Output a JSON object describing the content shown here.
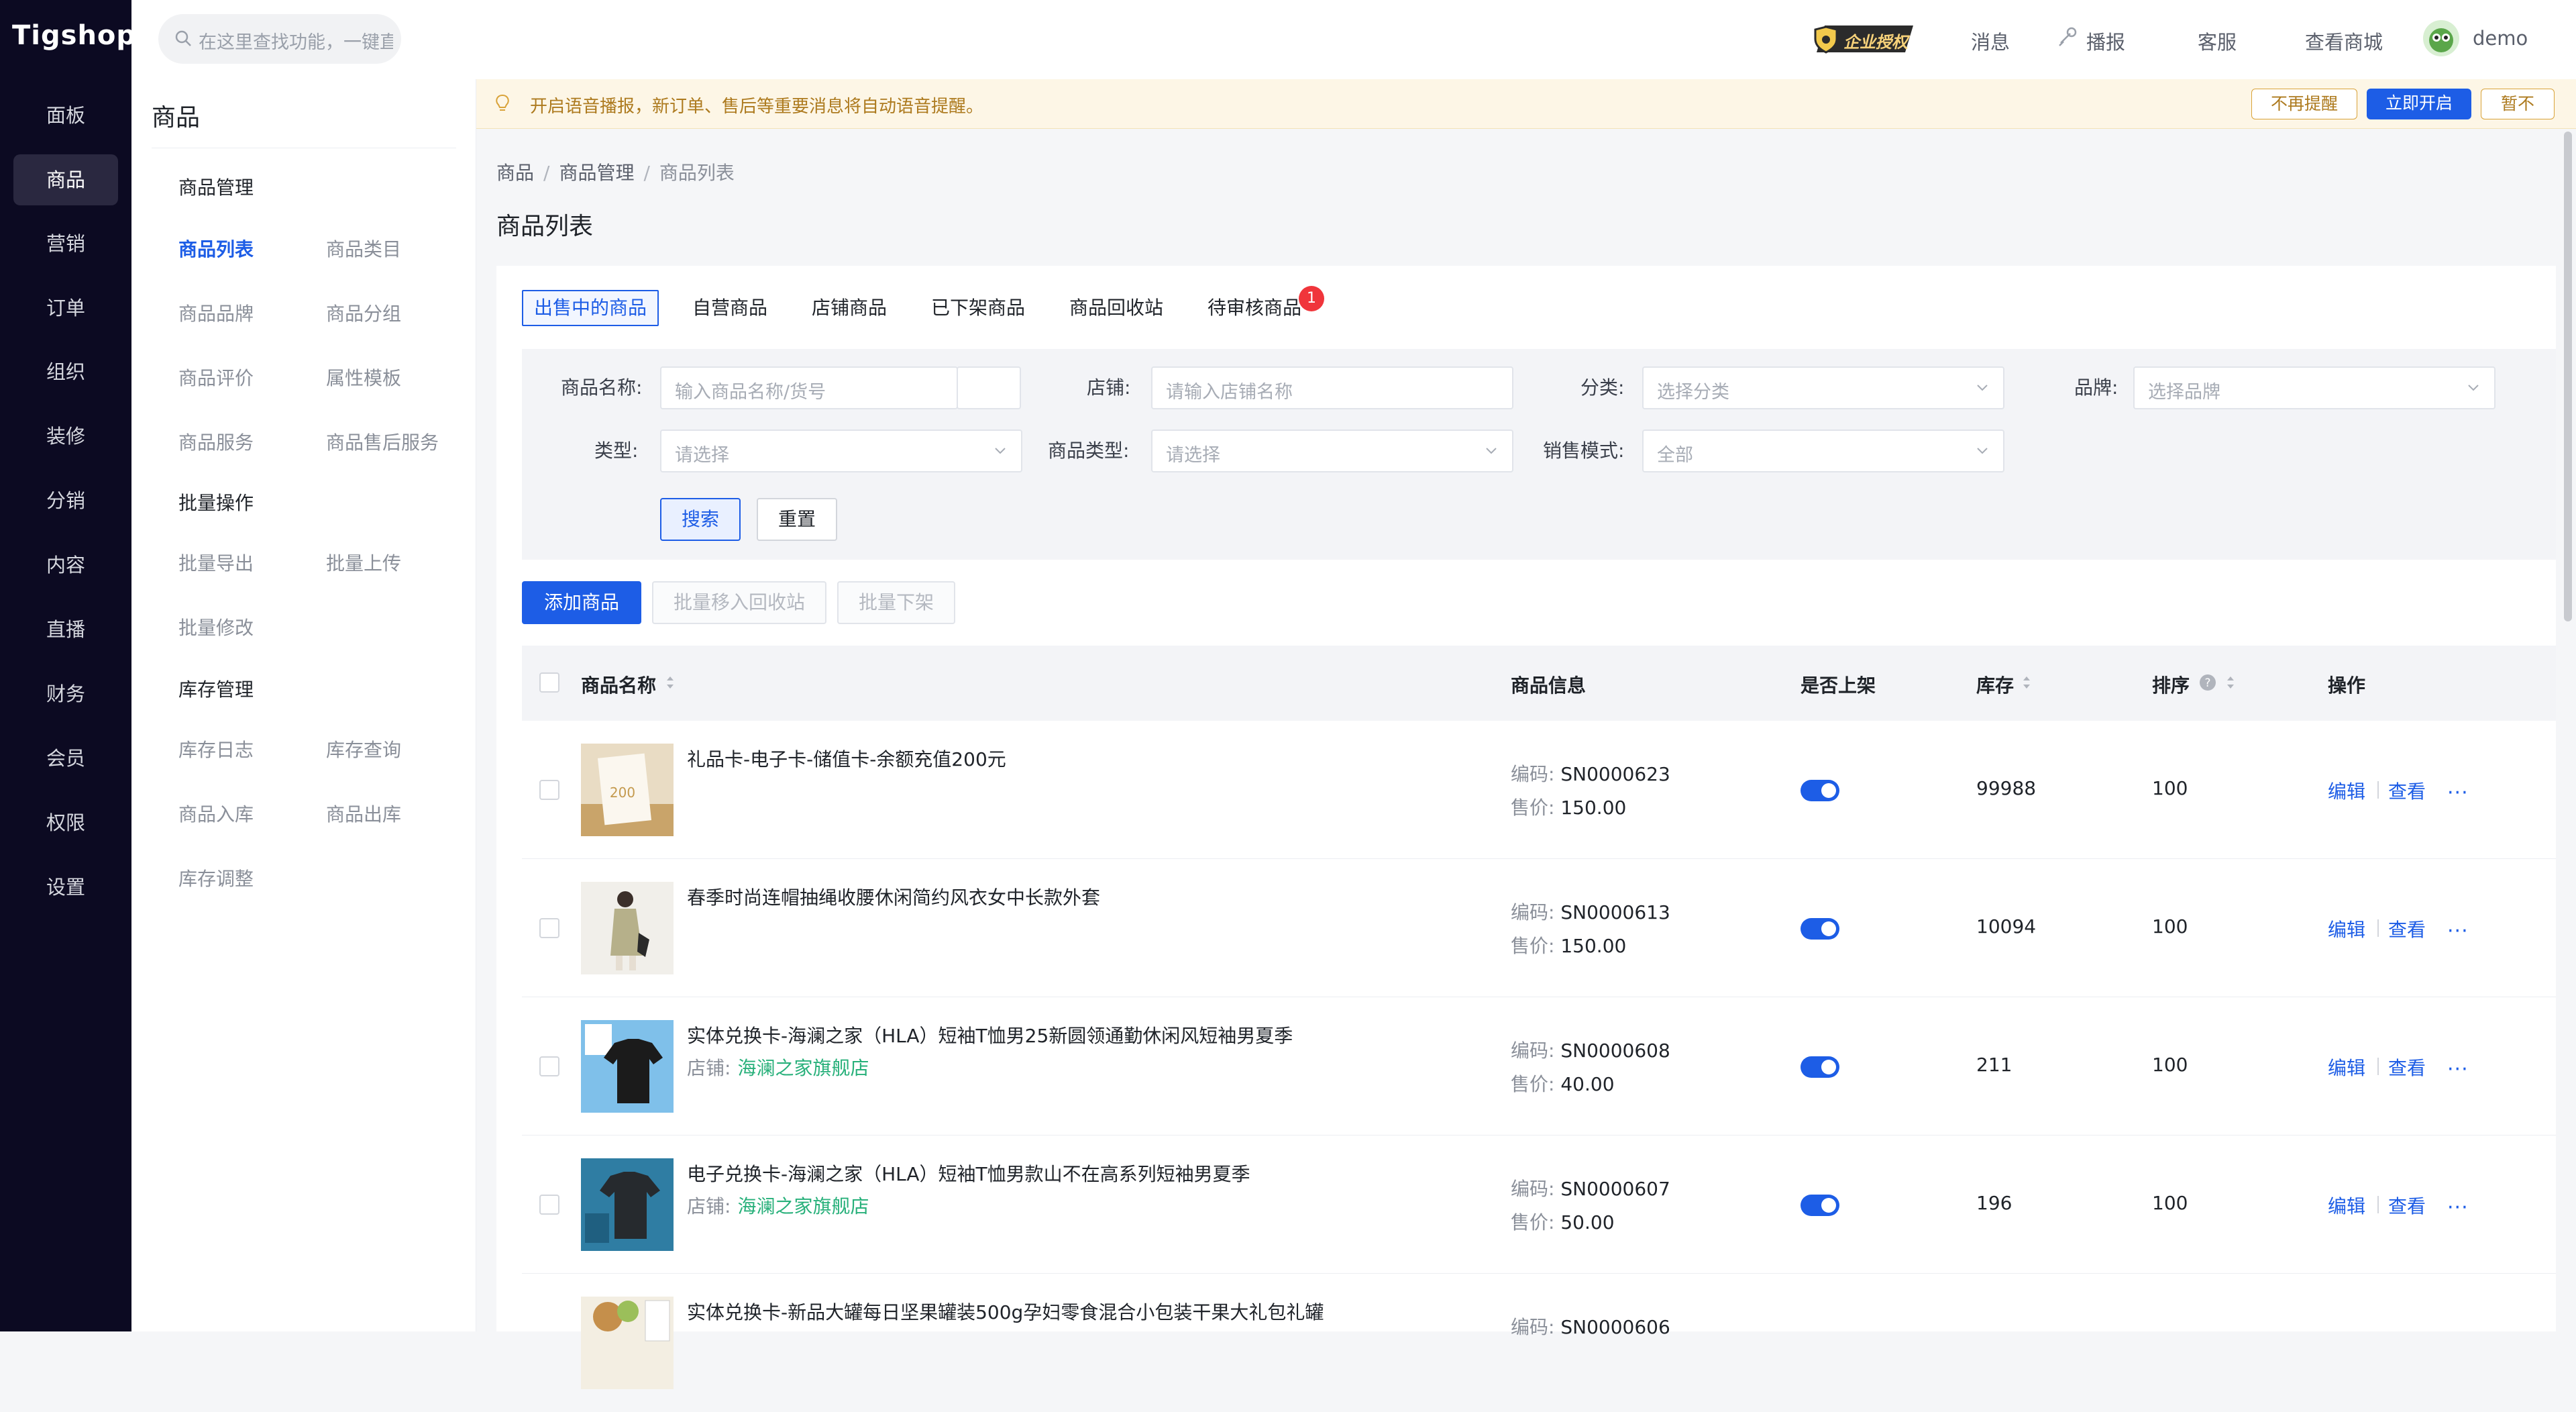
{
  "app": {
    "logo": "Tigshop"
  },
  "leftnav": {
    "items": [
      {
        "label": "面板"
      },
      {
        "label": "商品"
      },
      {
        "label": "营销"
      },
      {
        "label": "订单"
      },
      {
        "label": "组织"
      },
      {
        "label": "装修"
      },
      {
        "label": "分销"
      },
      {
        "label": "内容"
      },
      {
        "label": "直播"
      },
      {
        "label": "财务"
      },
      {
        "label": "会员"
      },
      {
        "label": "权限"
      },
      {
        "label": "设置"
      }
    ],
    "active_index": 1
  },
  "topbar": {
    "search_placeholder": "在这里查找功能，一键直达",
    "badge": "企业授权",
    "links": {
      "messages": "消息",
      "broadcast": "播报",
      "service": "客服",
      "view_shop": "查看商城"
    },
    "user": "demo"
  },
  "notice": {
    "text": "开启语音播报，新订单、售后等重要消息将自动语音提醒。",
    "no_remind": "不再提醒",
    "enable_now": "立即开启",
    "later": "暂不"
  },
  "submenu": {
    "title": "商品",
    "groups": [
      {
        "title": "商品管理",
        "items": [
          "商品列表",
          "商品类目",
          "商品品牌",
          "商品分组",
          "商品评价",
          "属性模板",
          "商品服务",
          "商品售后服务"
        ]
      },
      {
        "title": "批量操作",
        "items": [
          "批量导出",
          "批量上传",
          "批量修改"
        ]
      },
      {
        "title": "库存管理",
        "items": [
          "库存日志",
          "库存查询",
          "商品入库",
          "商品出库",
          "库存调整"
        ]
      }
    ]
  },
  "breadcrumb": [
    "商品",
    "商品管理",
    "商品列表"
  ],
  "page_title": "商品列表",
  "tabs": [
    {
      "label": "出售中的商品"
    },
    {
      "label": "自营商品"
    },
    {
      "label": "店铺商品"
    },
    {
      "label": "已下架商品"
    },
    {
      "label": "商品回收站"
    },
    {
      "label": "待审核商品",
      "badge": "1"
    }
  ],
  "filter": {
    "name_label": "商品名称:",
    "name_placeholder": "输入商品名称/货号",
    "shop_label": "店铺:",
    "shop_placeholder": "请输入店铺名称",
    "category_label": "分类:",
    "category_placeholder": "选择分类",
    "brand_label": "品牌:",
    "brand_placeholder": "选择品牌",
    "type_label": "类型:",
    "type_placeholder": "请选择",
    "goods_type_label": "商品类型:",
    "goods_type_placeholder": "请选择",
    "sale_mode_label": "销售模式:",
    "sale_mode_value": "全部",
    "search": "搜索",
    "reset": "重置"
  },
  "actions": {
    "add": "添加商品",
    "batch_recycle": "批量移入回收站",
    "batch_off": "批量下架"
  },
  "table": {
    "headers": {
      "name": "商品名称",
      "info": "商品信息",
      "on_sale": "是否上架",
      "stock": "库存",
      "sort": "排序",
      "ops": "操作"
    },
    "code_label": "编码:",
    "price_label": "售价:",
    "shop_label": "店铺:",
    "edit": "编辑",
    "view": "查看",
    "rows": [
      {
        "name": "礼品卡-电子卡-储值卡-余额充值200元",
        "shop": "",
        "code": "SN0000623",
        "price": "150.00",
        "on_sale": true,
        "stock": "99988",
        "sort": "100"
      },
      {
        "name": "春季时尚连帽抽绳收腰休闲简约风衣女中长款外套",
        "shop": "",
        "code": "SN0000613",
        "price": "150.00",
        "on_sale": true,
        "stock": "10094",
        "sort": "100"
      },
      {
        "name": "实体兑换卡-海澜之家（HLA）短袖T恤男25新圆领通勤休闲风短袖男夏季",
        "shop": "海澜之家旗舰店",
        "code": "SN0000608",
        "price": "40.00",
        "on_sale": true,
        "stock": "211",
        "sort": "100"
      },
      {
        "name": "电子兑换卡-海澜之家（HLA）短袖T恤男款山不在高系列短袖男夏季",
        "shop": "海澜之家旗舰店",
        "code": "SN0000607",
        "price": "50.00",
        "on_sale": true,
        "stock": "196",
        "sort": "100"
      },
      {
        "name": "实体兑换卡-新品大罐每日坚果罐装500g孕妇零食混合小包装干果大礼包礼罐",
        "shop": "",
        "code": "SN0000606",
        "price": "",
        "on_sale": true,
        "stock": "",
        "sort": ""
      }
    ]
  },
  "colors": {
    "primary": "#1d5de6",
    "nav_bg": "#0c0a22",
    "shop_link": "#27b07a",
    "notice_text": "#ad7a1e",
    "badge": "#f0353b"
  }
}
